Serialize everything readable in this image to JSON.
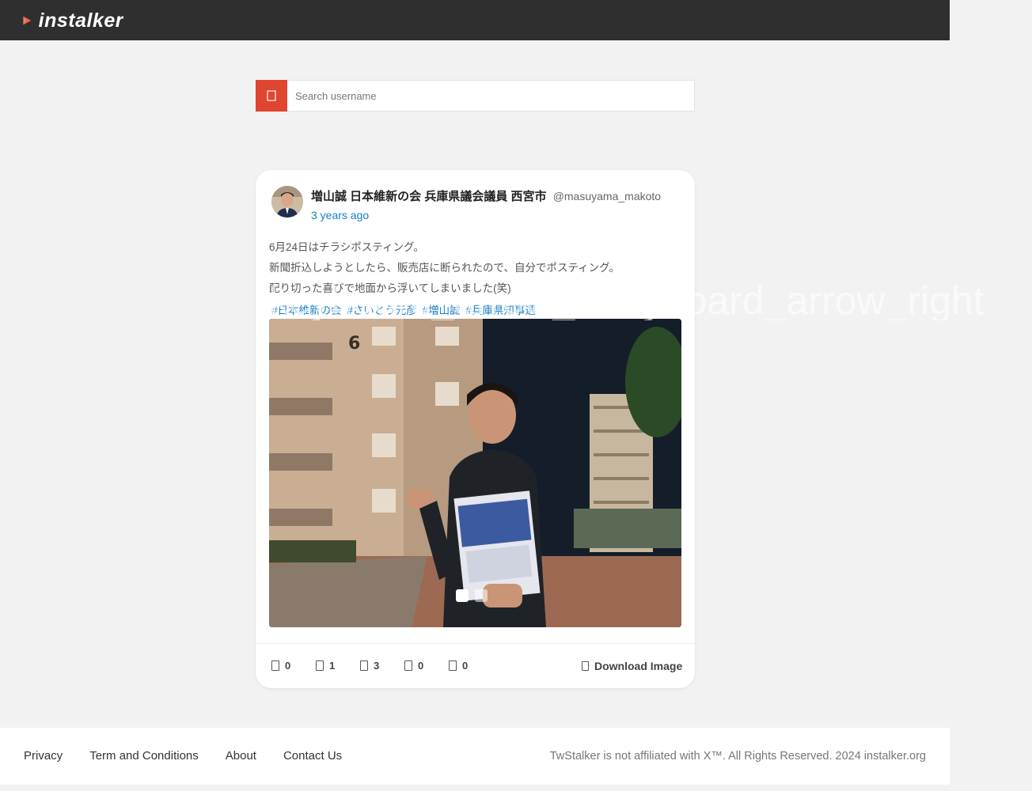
{
  "header": {
    "logo_text": "instalker"
  },
  "search": {
    "placeholder": "Search username",
    "icon": "search-icon"
  },
  "post": {
    "author_name": "増山誠 日本維新の会 兵庫県議会議員 西宮市",
    "author_handle": "@masuyama_makoto",
    "time": "3 years ago",
    "lines": [
      "6月24日はチラシポスティング。",
      "新聞折込しようとしたら、販売店に断られたので、自分でポスティング。",
      "配り切った喜びで地面から浮いてしまいました(笑)"
    ],
    "tags": [
      "#日本維新の会",
      "#さいとう元彦",
      "#増山誠",
      "#兵庫県知事選"
    ],
    "carousel": {
      "prev_label": "keyboard_arrow_left",
      "next_label": "keyboard_arrow_right"
    },
    "stats": [
      "0",
      "1",
      "3",
      "0",
      "0"
    ],
    "download_label": "Download Image"
  },
  "footer": {
    "links": [
      "Privacy",
      "Term and Conditions",
      "About",
      "Contact Us"
    ],
    "copyright": "TwStalker is not affiliated with X™. All Rights Reserved.  2024 instalker.org"
  },
  "colors": {
    "accent": "#e0452f",
    "link": "#1a7fc7",
    "topbar": "#2f2f2f"
  }
}
